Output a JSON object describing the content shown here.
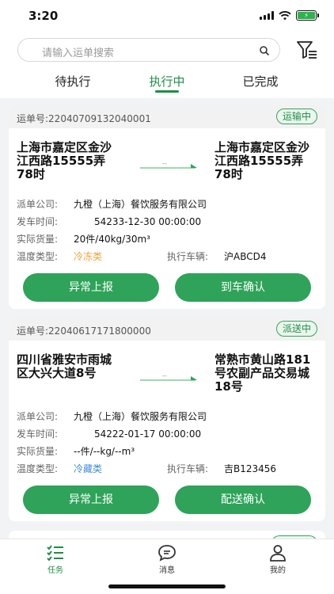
{
  "status_bar": {
    "time": "3:20",
    "battery": "⚡"
  },
  "search": {
    "placeholder": "请输入运单搜索"
  },
  "tabs": [
    {
      "label": "待执行"
    },
    {
      "label": "执行中",
      "active": true
    },
    {
      "label": "已完成"
    }
  ],
  "cards": [
    {
      "waybill": "运单号:22040709132040001",
      "status": "运输中",
      "from": "上海市嘉定区金沙江西路15555弄78时",
      "to": "上海市嘉定区金沙江西路15555弄78时",
      "route_label": "--",
      "dispatch_label": "派单公司:",
      "dispatch_value": "九橙（上海）餐饮服务有限公司",
      "depart_label": "发车时间:",
      "depart_value": "54233-12-30 00:00:00",
      "cargo_label": "实际货量:",
      "cargo_value": "20件/40kg/30m³",
      "temp_label": "温度类型:",
      "temp_value": "冷冻类",
      "vehicle_label": "执行车辆:",
      "vehicle_value": "沪ABCD4",
      "btn_left": "异常上报",
      "btn_right": "到车确认"
    },
    {
      "waybill": "运单号:22040617171800000",
      "status": "派送中",
      "from": "四川省雅安市雨城区大兴大道8号",
      "to": "常熟市黄山路181号农副产品交易城18号",
      "route_label": "--",
      "dispatch_label": "派单公司:",
      "dispatch_value": "九橙（上海）餐饮服务有限公司",
      "depart_label": "发车时间:",
      "depart_value": "54222-01-17 00:00:00",
      "cargo_label": "实际货量:",
      "cargo_value": "--件/--kg/--m³",
      "temp_label": "温度类型:",
      "temp_value": "冷藏类",
      "vehicle_label": "执行车辆:",
      "vehicle_value": "吉B123456",
      "btn_left": "异常上报",
      "btn_right": "配送确认"
    }
  ],
  "bottom_nav": [
    {
      "label": "任务",
      "icon": "task-list-icon",
      "active": true
    },
    {
      "label": "消息",
      "icon": "message-icon"
    },
    {
      "label": "我的",
      "icon": "user-icon"
    }
  ],
  "colors": {
    "brand": "#1e8d46",
    "button": "#2ea359",
    "frozen": "#f0a23b",
    "cold": "#3c8be0"
  }
}
